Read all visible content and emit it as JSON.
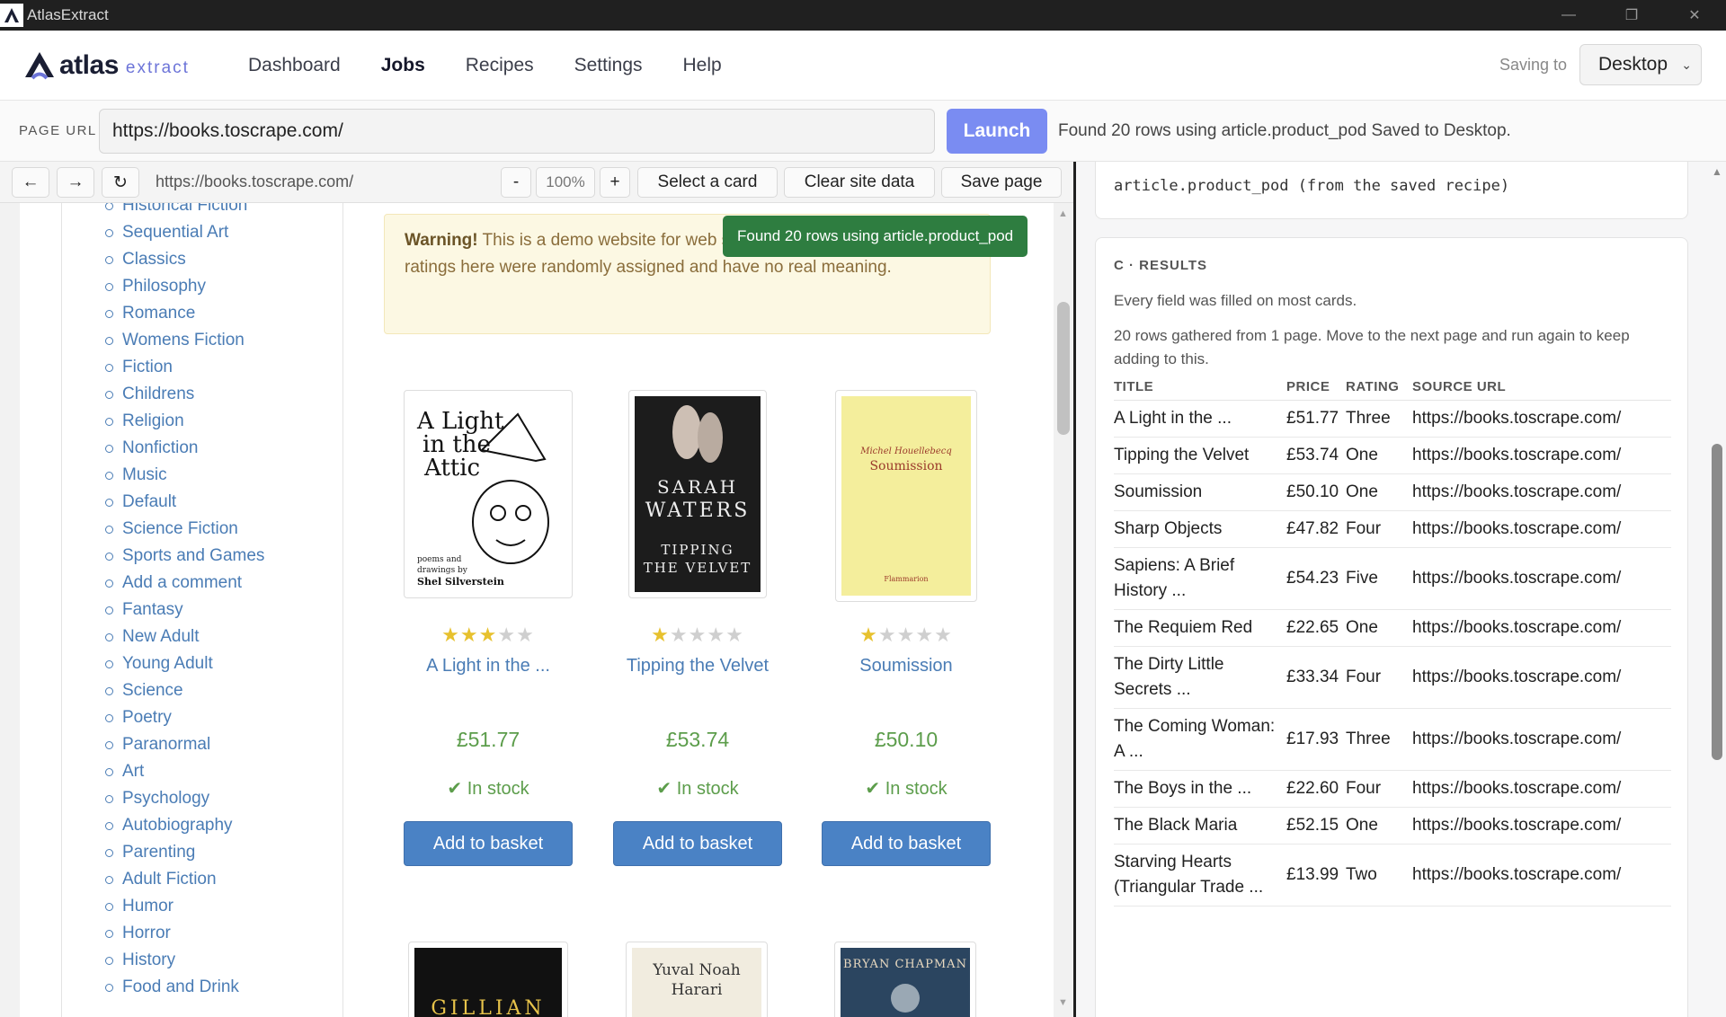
{
  "window": {
    "title": "AtlasExtract",
    "controls": {
      "minimize": "—",
      "restore": "❐",
      "close": "✕"
    }
  },
  "header": {
    "logo_word": "atlas",
    "logo_sub": "extract",
    "nav": [
      {
        "label": "Dashboard",
        "active": false
      },
      {
        "label": "Jobs",
        "active": true
      },
      {
        "label": "Recipes",
        "active": false
      },
      {
        "label": "Settings",
        "active": false
      },
      {
        "label": "Help",
        "active": false
      }
    ],
    "saving_label": "Saving to",
    "saving_value": "Desktop"
  },
  "urlbar": {
    "label": "PAGE URL",
    "value": "https://books.toscrape.com/",
    "launch_label": "Launch",
    "status": "Found 20 rows using article.product_pod Saved to Desktop."
  },
  "browser": {
    "back": "←",
    "forward": "→",
    "reload": "↻",
    "url": "https://books.toscrape.com/",
    "zoom_minus": "-",
    "zoom": "100%",
    "zoom_plus": "+",
    "select_card": "Select a card",
    "clear_site_data": "Clear site data",
    "save_page": "Save page"
  },
  "site": {
    "categories": [
      "Historical Fiction",
      "Sequential Art",
      "Classics",
      "Philosophy",
      "Romance",
      "Womens Fiction",
      "Fiction",
      "Childrens",
      "Religion",
      "Nonfiction",
      "Music",
      "Default",
      "Science Fiction",
      "Sports and Games",
      "Add a comment",
      "Fantasy",
      "New Adult",
      "Young Adult",
      "Science",
      "Poetry",
      "Paranormal",
      "Art",
      "Psychology",
      "Autobiography",
      "Parenting",
      "Adult Fiction",
      "Humor",
      "Horror",
      "History",
      "Food and Drink"
    ],
    "warning_strong": "Warning!",
    "warning_text": " This is a demo website for web scraping purposes. Prices and ratings here were randomly assigned and have no real meaning.",
    "toast": "Found 20 rows using article.product_pod",
    "products": [
      {
        "title": "A Light in the ...",
        "price": "£51.77",
        "stock": "In stock",
        "rating": 3,
        "button": "Add to basket",
        "cover": {
          "line1": "A Light",
          "line2": "in the",
          "line3": "Attic",
          "small1": "poems and",
          "small2": "drawings by",
          "small3": "Shel Silverstein"
        }
      },
      {
        "title": "Tipping the Velvet",
        "price": "£53.74",
        "stock": "In stock",
        "rating": 1,
        "button": "Add to basket",
        "cover": {
          "line1": "SARAH",
          "line2": "WATERS",
          "line3": "TIPPING",
          "line4": "THE VELVET"
        }
      },
      {
        "title": "Soumission",
        "price": "£50.10",
        "stock": "In stock",
        "rating": 1,
        "button": "Add to basket",
        "cover": {
          "line1": "Michel Houellebecq",
          "line2": "Soumission",
          "line3": "Flammarion"
        }
      }
    ],
    "covers_row2": {
      "c1": "GILLIAN",
      "c2a": "Yuval Noah",
      "c2b": "Harari",
      "c3": "BRYAN CHAPMAN"
    }
  },
  "panel": {
    "selector_text": "article.product_pod (from the saved recipe)",
    "results_heading": "C · RESULTS",
    "line1": "Every field was filled on most cards.",
    "line2": "20 rows gathered from 1 page. Move to the next page and run again to keep adding to this.",
    "columns": [
      "TITLE",
      "PRICE",
      "RATING",
      "SOURCE URL"
    ],
    "rows": [
      {
        "title": "A Light in the ...",
        "price": "£51.77",
        "rating": "Three",
        "url": "https://books.toscrape.com/"
      },
      {
        "title": "Tipping the Velvet",
        "price": "£53.74",
        "rating": "One",
        "url": "https://books.toscrape.com/"
      },
      {
        "title": "Soumission",
        "price": "£50.10",
        "rating": "One",
        "url": "https://books.toscrape.com/"
      },
      {
        "title": "Sharp Objects",
        "price": "£47.82",
        "rating": "Four",
        "url": "https://books.toscrape.com/"
      },
      {
        "title": "Sapiens: A Brief History ...",
        "price": "£54.23",
        "rating": "Five",
        "url": "https://books.toscrape.com/"
      },
      {
        "title": "The Requiem Red",
        "price": "£22.65",
        "rating": "One",
        "url": "https://books.toscrape.com/"
      },
      {
        "title": "The Dirty Little Secrets ...",
        "price": "£33.34",
        "rating": "Four",
        "url": "https://books.toscrape.com/"
      },
      {
        "title": "The Coming Woman: A ...",
        "price": "£17.93",
        "rating": "Three",
        "url": "https://books.toscrape.com/"
      },
      {
        "title": "The Boys in the ...",
        "price": "£22.60",
        "rating": "Four",
        "url": "https://books.toscrape.com/"
      },
      {
        "title": "The Black Maria",
        "price": "£52.15",
        "rating": "One",
        "url": "https://books.toscrape.com/"
      },
      {
        "title": "Starving Hearts (Triangular Trade ...",
        "price": "£13.99",
        "rating": "Two",
        "url": "https://books.toscrape.com/"
      }
    ]
  },
  "colors": {
    "accent": "#7a8cf2",
    "link": "#4a7cb5",
    "price": "#5c9d4b",
    "toast": "#2e7d40",
    "star_on": "#e7c12e"
  }
}
